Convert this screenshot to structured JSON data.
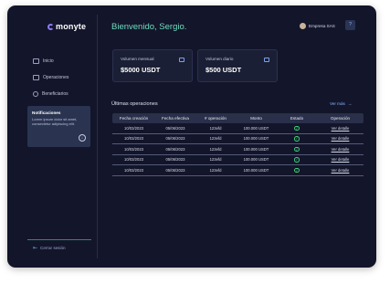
{
  "app": {
    "logo_text": "monyte"
  },
  "sidebar": {
    "items": [
      {
        "label": "Inicio",
        "icon": "home-icon"
      },
      {
        "label": "Operaciones",
        "icon": "operations-icon"
      },
      {
        "label": "Beneficiarios",
        "icon": "users-icon"
      }
    ],
    "notification": {
      "title": "Notificaciones",
      "text": "Lorem ipsum dolor sit amet, consectetur adipiscing elit."
    },
    "logout_label": "Cerrar sesión"
  },
  "header": {
    "greeting": "Bienvenido, Sergio.",
    "company": "Empresa SAS",
    "help_label": "?"
  },
  "cards": [
    {
      "label": "Volumen mensual",
      "value": "$5000 USDT",
      "icon": "export-icon"
    },
    {
      "label": "Volumen diario",
      "value": "$500 USDT",
      "icon": "chat-icon"
    }
  ],
  "operations": {
    "title": "Últimas operaciones",
    "see_more": "Ver más",
    "columns": [
      "Fecha creación",
      "Fecha efectiva",
      "# operación",
      "Monto",
      "Estado",
      "Operación"
    ],
    "rows": [
      {
        "created": "10/03/2023",
        "effective": "05/06/2023",
        "op": "123efd",
        "amount": "100.000 USDT",
        "status": "completed",
        "action": "Ver detalle"
      },
      {
        "created": "10/03/2023",
        "effective": "05/06/2023",
        "op": "123efd",
        "amount": "100.000 USDT",
        "status": "completed",
        "action": "Ver detalle"
      },
      {
        "created": "10/03/2023",
        "effective": "05/06/2023",
        "op": "123efd",
        "amount": "100.000 USDT",
        "status": "completed",
        "action": "Ver detalle"
      },
      {
        "created": "10/03/2023",
        "effective": "05/06/2023",
        "op": "123efd",
        "amount": "100.000 USDT",
        "status": "completed",
        "action": "Ver detalle"
      },
      {
        "created": "10/03/2023",
        "effective": "05/06/2023",
        "op": "123efd",
        "amount": "100.000 USDT",
        "status": "completed",
        "action": "Ver detalle"
      }
    ]
  },
  "colors": {
    "background": "#13152a",
    "accent_green": "#6fdcc0",
    "link_blue": "#8ab4ff",
    "status_ok": "#3fcf7a"
  }
}
